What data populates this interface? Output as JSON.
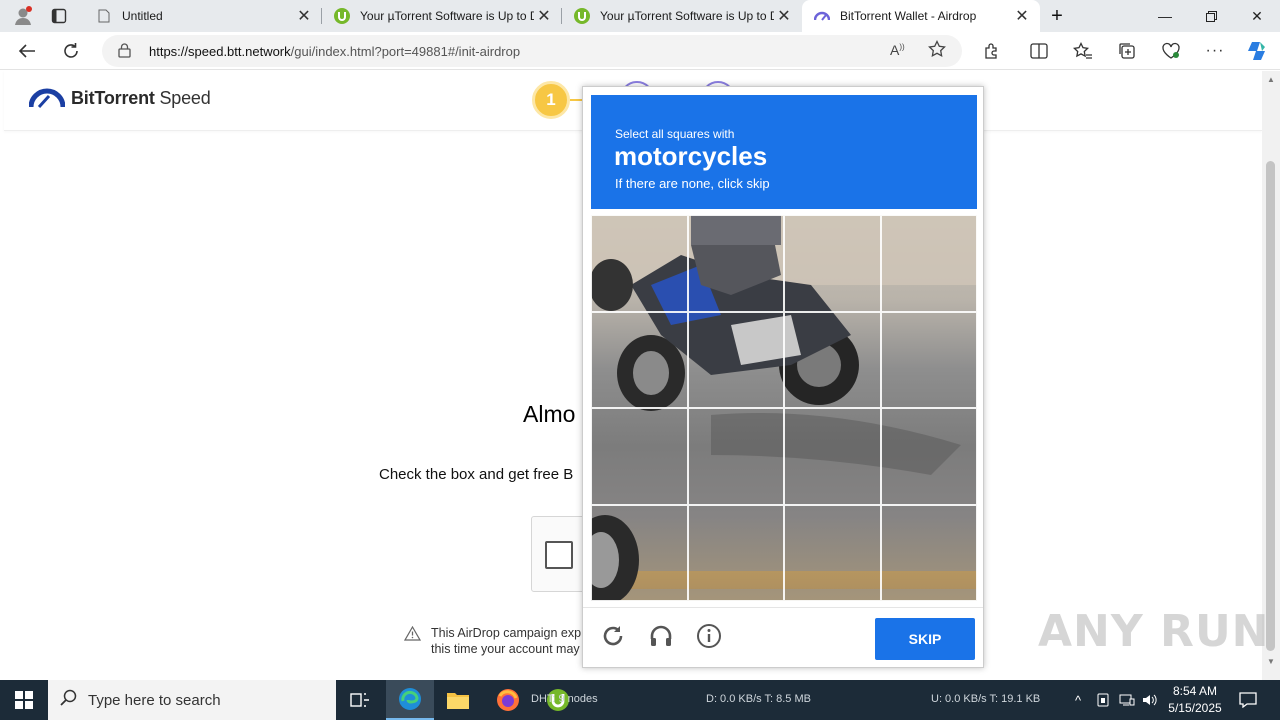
{
  "browser": {
    "tabs": [
      {
        "title": "Untitled",
        "active": false
      },
      {
        "title": "Your µTorrent Software is Up to D",
        "active": false
      },
      {
        "title": "Your µTorrent Software is Up to D",
        "active": false
      },
      {
        "title": "BitTorrent Wallet - Airdrop",
        "active": true
      }
    ],
    "url_host": "https://speed.btt.network",
    "url_path": "/gui/index.html?port=49881#/init-airdrop"
  },
  "page": {
    "logo_bold": "BitTorrent",
    "logo_light": "Speed",
    "step_number": "1",
    "heading_partial": "Almo",
    "check_text_partial": "Check the box and get free B",
    "check_text_end": ".",
    "warning_line1": "This AirDrop campaign exp",
    "warning_line2": "this time your account may"
  },
  "captcha": {
    "prompt": "Select all squares with",
    "target": "motorcycles",
    "none_hint": "If there are none, click skip",
    "skip_label": "SKIP",
    "grid_rows": 4,
    "grid_cols": 4
  },
  "watermark": "ANY RUN",
  "taskbar": {
    "search_placeholder": "Type here to search",
    "dht_text": "DHT: 9 nodes",
    "download_text": "D: 0.0 KB/s T: 8.5 MB",
    "upload_text": "U: 0.0 KB/s T: 19.1 KB",
    "time": "8:54 AM",
    "date": "5/15/2025"
  },
  "colors": {
    "captcha_blue": "#1a73e8",
    "step_yellow": "#f7c744",
    "taskbar_bg": "#1c2b38"
  }
}
